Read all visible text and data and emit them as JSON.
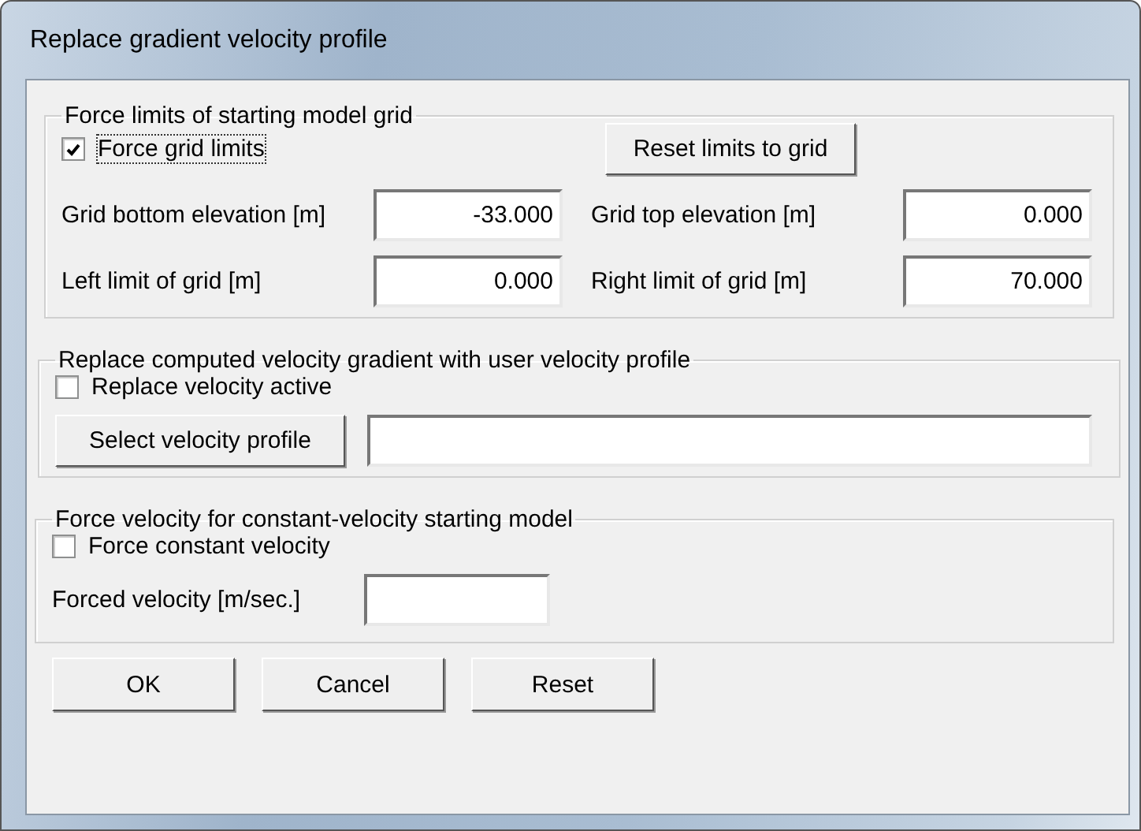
{
  "window": {
    "title": "Replace gradient velocity profile"
  },
  "grid_limits": {
    "legend": "Force limits of starting model grid",
    "force_checkbox": {
      "label": "Force grid limits",
      "checked": true
    },
    "reset_button": "Reset limits to grid",
    "fields": [
      {
        "label": "Grid bottom elevation [m]",
        "value": "-33.000"
      },
      {
        "label": "Grid top elevation [m]",
        "value": "0.000"
      },
      {
        "label": "Left limit of grid [m]",
        "value": "0.000"
      },
      {
        "label": "Right limit of grid [m]",
        "value": "70.000"
      }
    ]
  },
  "velocity_profile": {
    "legend": "Replace computed velocity gradient with user velocity profile",
    "active_checkbox": {
      "label": "Replace velocity active",
      "checked": false
    },
    "select_button": "Select velocity profile"
  },
  "constant_velocity": {
    "legend": "Force velocity for constant-velocity starting model",
    "force_checkbox": {
      "label": "Force constant velocity",
      "checked": false
    },
    "field_label": "Forced velocity [m/sec.]"
  },
  "buttons": [
    "OK",
    "Cancel",
    "Reset"
  ]
}
